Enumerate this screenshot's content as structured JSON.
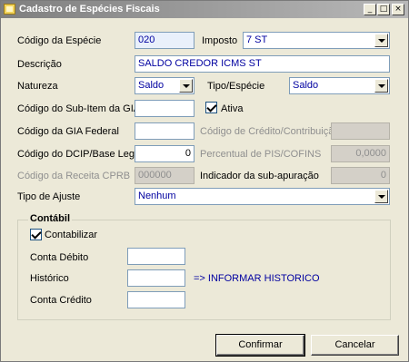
{
  "window": {
    "title": "Cadastro de Espécies Fiscais",
    "controls": {
      "minimize": "_",
      "maximize": "□",
      "close": "×"
    }
  },
  "form": {
    "codigo_especie": {
      "label": "Código da Espécie",
      "value": "020"
    },
    "imposto": {
      "label": "Imposto",
      "value": "7 ST"
    },
    "descricao": {
      "label": "Descrição",
      "value": "SALDO CREDOR ICMS ST"
    },
    "natureza": {
      "label": "Natureza",
      "value": "Saldo"
    },
    "tipo_especie": {
      "label": "Tipo/Espécie",
      "value": "Saldo"
    },
    "sub_item_gia": {
      "label": "Código do Sub-Item da GIA",
      "value": ""
    },
    "ativa": {
      "label": "Ativa",
      "checked": true
    },
    "gia_federal": {
      "label": "Código da GIA Federal",
      "value": ""
    },
    "credito_contribuicao": {
      "label": "Código de Crédito/Contribuição",
      "value": ""
    },
    "dcip": {
      "label": "Código do DCIP/Base Legal",
      "value": "0"
    },
    "pis_cofins": {
      "label": "Percentual de PIS/COFINS",
      "value": "0,0000"
    },
    "receita_cprb": {
      "label": "Código da Receita CPRB",
      "value": "000000"
    },
    "sub_apuracao": {
      "label": "Indicador da sub-apuração",
      "value": "0"
    },
    "tipo_ajuste": {
      "label": "Tipo de Ajuste",
      "value": "Nenhum"
    }
  },
  "contabil": {
    "title": "Contábil",
    "contabilizar": {
      "label": "Contabilizar",
      "checked": true
    },
    "conta_debito": {
      "label": "Conta Débito",
      "value": ""
    },
    "historico": {
      "label": "Histórico",
      "value": "",
      "hint": "=> INFORMAR HISTORICO"
    },
    "conta_credito": {
      "label": "Conta Crédito",
      "value": ""
    }
  },
  "buttons": {
    "confirmar": "Confirmar",
    "cancelar": "Cancelar"
  }
}
